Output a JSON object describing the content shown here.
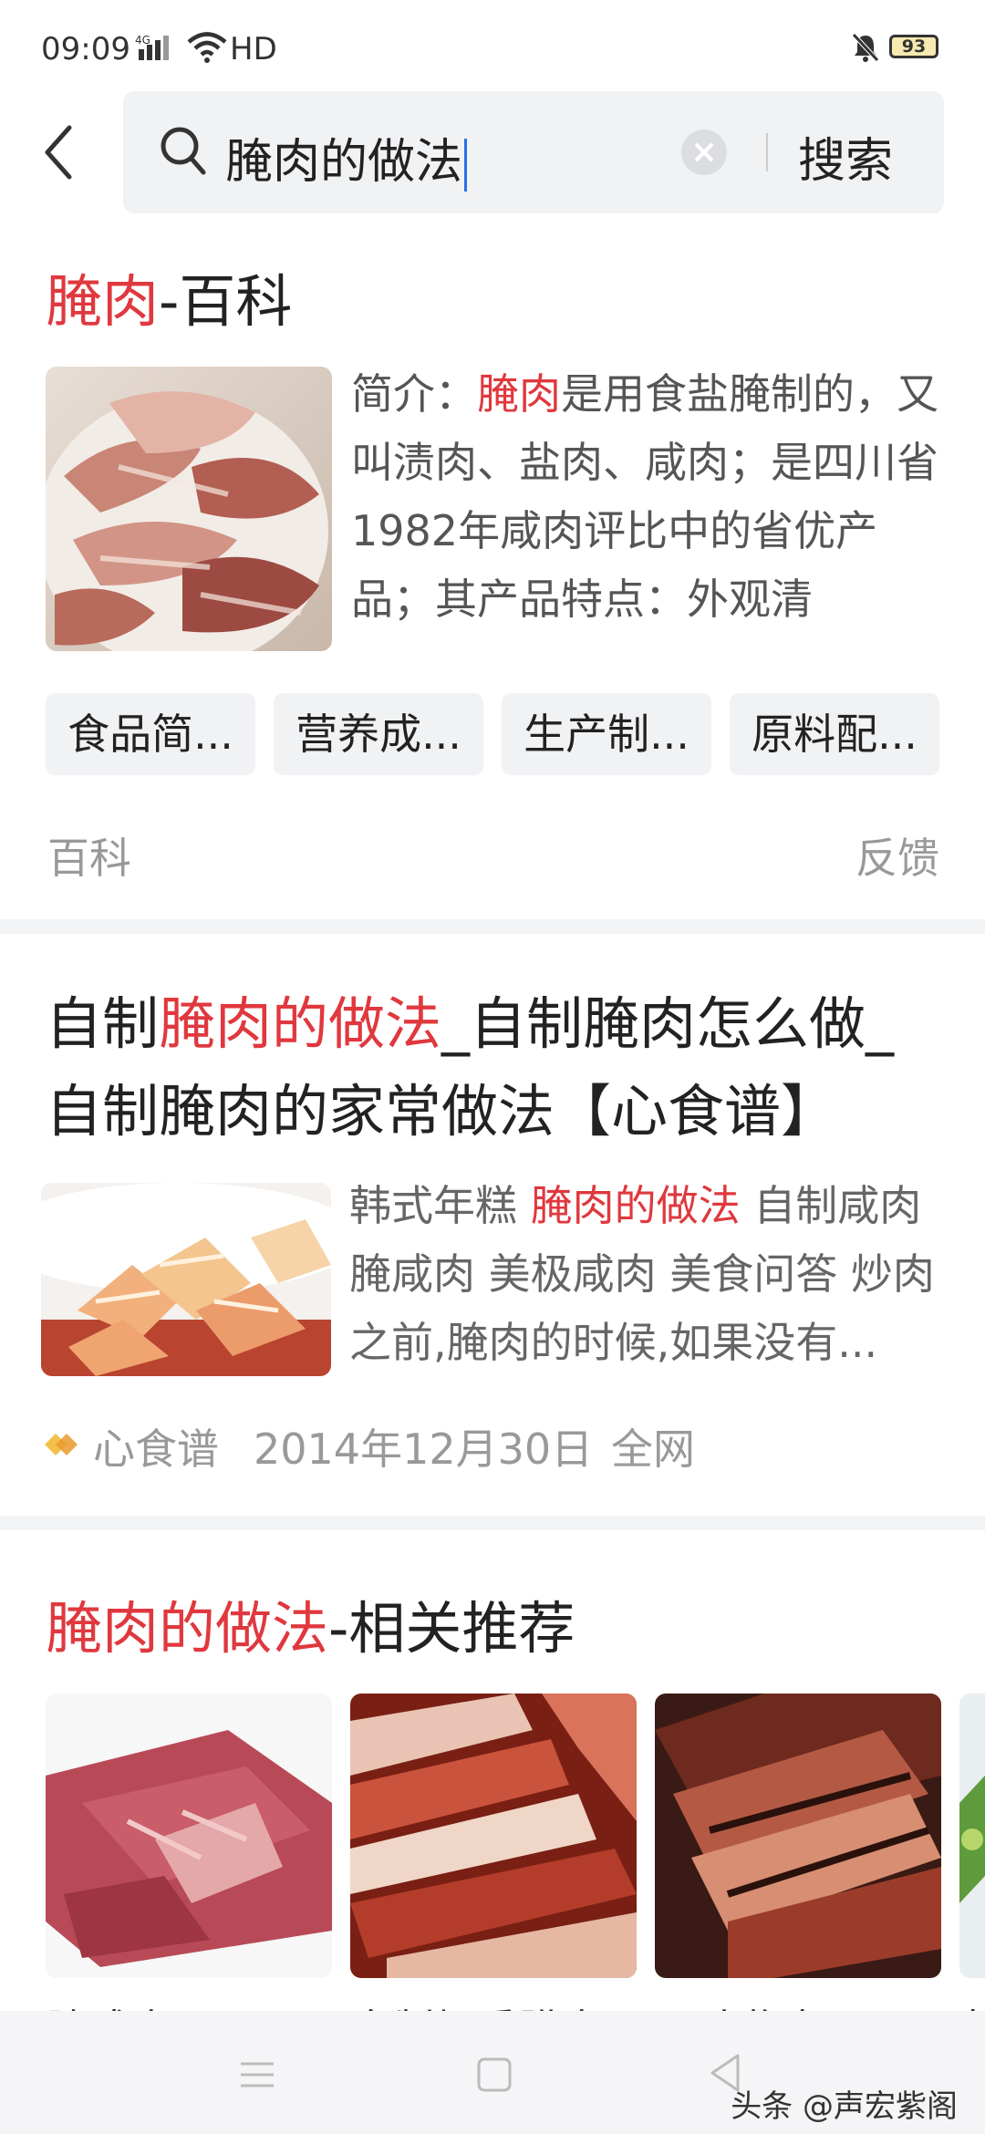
{
  "status_bar": {
    "time": "09:09",
    "network": "4G",
    "hd": "HD",
    "battery": "93"
  },
  "search": {
    "query": "腌肉的做法",
    "submit_label": "搜索"
  },
  "baike_card": {
    "title_highlight": "腌肉",
    "title_rest": "-百科",
    "intro_prefix": "简介：",
    "intro_highlight": "腌肉",
    "intro_rest": "是用食盐腌制的，又叫渍肉、盐肉、咸肉；是四川省1982年咸肉评比中的省优产品；其产品特点：外观清",
    "chips": [
      "食品简...",
      "营养成...",
      "生产制...",
      "原料配..."
    ],
    "source": "百科",
    "feedback": "反馈"
  },
  "recipe_card": {
    "title_prefix": "自制",
    "title_highlight": "腌肉的做法",
    "title_rest": "_自制腌肉怎么做_自制腌肉的家常做法【心食谱】",
    "snippet_prefix": "韩式年糕 ",
    "snippet_highlight": "腌肉的做法",
    "snippet_rest": " 自制咸肉 腌咸肉 美极咸肉 美食问答 炒肉之前,腌肉的时候,如果没有...",
    "source": "心食谱",
    "date": "2014年12月30日",
    "scope": "全网"
  },
  "related_card": {
    "title_highlight": "腌肉的做法",
    "title_rest": "-相关推荐",
    "items": [
      {
        "label": "腌咸肉"
      },
      {
        "label": "自制烟熏腊肉"
      },
      {
        "label": "风味酱肉"
      },
      {
        "label": "莴"
      }
    ]
  },
  "watermark": "头条 @声宏紫阁"
}
